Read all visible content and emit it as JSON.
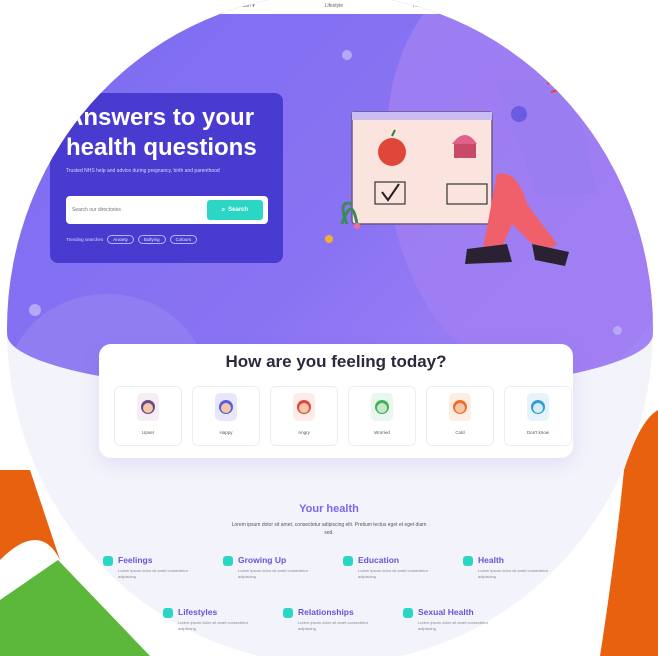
{
  "nav": {
    "items": [
      "Health ▾",
      "Lifestyle",
      "Re..."
    ]
  },
  "hero": {
    "title": "Answers to your health questions",
    "subtitle": "Trusted NHS help and advice during pregnancy, birth and parenthood",
    "search": {
      "placeholder": "Search our directories",
      "button": "Search"
    },
    "trending": {
      "label": "Trending searches",
      "chips": [
        "Anxiety",
        "Bullying",
        "Colours"
      ]
    }
  },
  "feelings": {
    "title": "How are you feeling today?",
    "moods": [
      {
        "label": "Upset",
        "color": "#6b4a8a"
      },
      {
        "label": "Happy",
        "color": "#5a5dd8"
      },
      {
        "label": "Angry",
        "color": "#e0473a"
      },
      {
        "label": "Worried",
        "color": "#3db35a"
      },
      {
        "label": "Cold",
        "color": "#f26b2d"
      },
      {
        "label": "Don't know",
        "color": "#2c9fd8"
      }
    ]
  },
  "your_health": {
    "title": "Your health",
    "desc": "Lorem ipsum dolor sit amet, consectetur adipiscing elit. Pretium lectus eget et eget diam sed.",
    "topics": [
      {
        "name": "Feelings",
        "desc": "Lorem ipsum dolor sit amet consectetur adipiscing",
        "color": "#2bd6c5"
      },
      {
        "name": "Growing Up",
        "desc": "Lorem ipsum dolor sit amet consectetur adipiscing",
        "color": "#2bd6c5"
      },
      {
        "name": "Education",
        "desc": "Lorem ipsum dolor sit amet consectetur adipiscing",
        "color": "#2bd6c5"
      },
      {
        "name": "Health",
        "desc": "Lorem ipsum dolor sit amet consectetur adipiscing",
        "color": "#2bd6c5"
      },
      {
        "name": "Lifestyles",
        "desc": "Lorem ipsum dolor sit amet consectetur adipiscing",
        "color": "#2bd6c5"
      },
      {
        "name": "Relationships",
        "desc": "Lorem ipsum dolor sit amet consectetur adipiscing",
        "color": "#2bd6c5"
      },
      {
        "name": "Sexual Health",
        "desc": "Lorem ipsum dolor sit amet consectetur adipiscing",
        "color": "#2bd6c5"
      }
    ]
  },
  "colors": {
    "orange": "#e8610f",
    "green": "#5cb83a",
    "purple": "#7b6cf0",
    "teal": "#2bd6c5"
  }
}
